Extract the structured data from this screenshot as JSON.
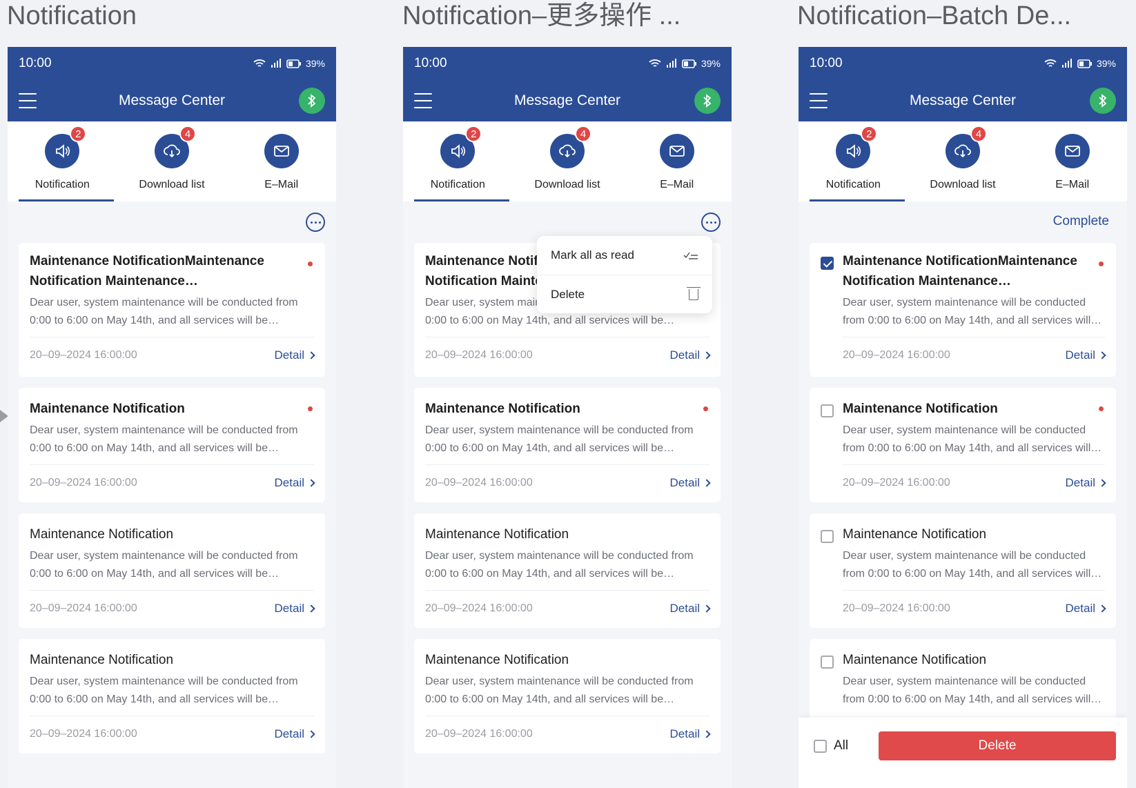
{
  "screens": [
    {
      "label": "Notification"
    },
    {
      "label": "Notification–更多操作 ..."
    },
    {
      "label": "Notification–Batch De..."
    }
  ],
  "status": {
    "time": "10:00",
    "battery": "39%",
    "icons": [
      "wifi-icon",
      "signal-icon",
      "battery-icon"
    ]
  },
  "header": {
    "title": "Message Center",
    "menu_icon": "hamburger-icon",
    "action_icon": "bluetooth-icon"
  },
  "tabs": [
    {
      "label": "Notification",
      "icon": "speaker-icon",
      "badge": "2",
      "active": true
    },
    {
      "label": "Download list",
      "icon": "cloud-download-icon",
      "badge": "4",
      "active": false
    },
    {
      "label": "E–Mail",
      "icon": "mail-icon",
      "badge": "",
      "active": false
    }
  ],
  "more_menu": {
    "items": [
      {
        "label": "Mark all as read",
        "icon": "check-list-icon"
      },
      {
        "label": "Delete",
        "icon": "trash-icon"
      }
    ]
  },
  "batch": {
    "complete_label": "Complete",
    "all_label": "All",
    "delete_label": "Delete"
  },
  "cards": [
    {
      "title": "Maintenance NotificationMaintenance Notification Maintenance NotificationMaintenance",
      "body": "Dear user, system maintenance will be conducted from 0:00 to 6:00 on May 14th, and all services will be unavailable during this time.",
      "time": "20–09–2024  16:00:00",
      "detail": "Detail",
      "unread": true
    },
    {
      "title": "Maintenance Notification",
      "body": "Dear user, system maintenance will be conducted from 0:00 to 6:00 on May 14th, and all services will be unavailable during this time.",
      "time": "20–09–2024  16:00:00",
      "detail": "Detail",
      "unread": true
    },
    {
      "title": "Maintenance Notification",
      "body": "Dear user, system maintenance will be conducted from 0:00 to 6:00 on May 14th, and all services will be unavailable during this time.",
      "time": "20–09–2024  16:00:00",
      "detail": "Detail",
      "unread": false
    },
    {
      "title": "Maintenance Notification",
      "body": "Dear user, system maintenance will be conducted from 0:00 to 6:00 on May 14th, and all services will be unavailable during this time.",
      "time": "20–09–2024  16:00:00",
      "detail": "Detail",
      "unread": false
    }
  ],
  "batch_selection": [
    true,
    false,
    false,
    false
  ],
  "colors": {
    "primary": "#2b4d96",
    "unread": "#e04646",
    "bluetooth": "#37b36a",
    "danger": "#e04a4a"
  }
}
